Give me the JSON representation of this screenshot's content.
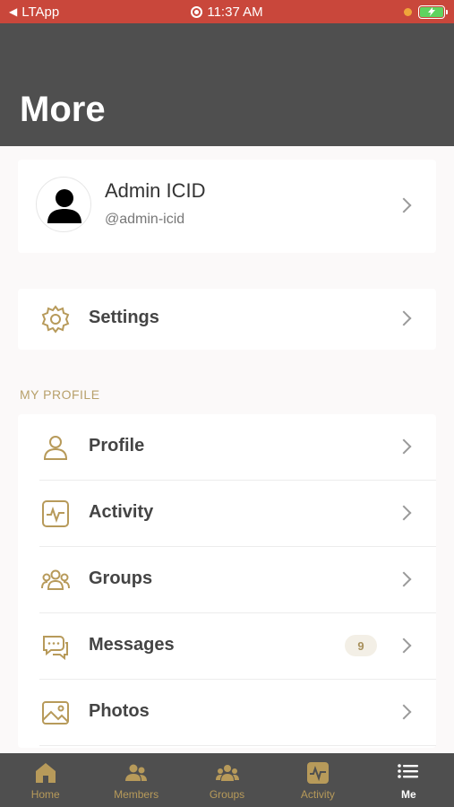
{
  "status_bar": {
    "back_app": "LTApp",
    "time": "11:37 AM",
    "bar_color": "#c9473b"
  },
  "header": {
    "title": "More",
    "bg": "#4f4f4f"
  },
  "user": {
    "name": "Admin ICID",
    "handle": "@admin-icid",
    "avatar_icon": "person-silhouette-icon"
  },
  "settings": {
    "label": "Settings",
    "icon": "gear-icon"
  },
  "my_profile": {
    "section_label": "MY PROFILE",
    "items": [
      {
        "label": "Profile",
        "icon": "person-icon"
      },
      {
        "label": "Activity",
        "icon": "activity-icon"
      },
      {
        "label": "Groups",
        "icon": "groups-icon"
      },
      {
        "label": "Messages",
        "icon": "messages-icon",
        "badge": "9"
      },
      {
        "label": "Photos",
        "icon": "photos-icon"
      }
    ]
  },
  "tabbar": {
    "items": [
      {
        "label": "Home",
        "icon": "home-icon"
      },
      {
        "label": "Members",
        "icon": "members-icon"
      },
      {
        "label": "Groups",
        "icon": "groups-icon"
      },
      {
        "label": "Activity",
        "icon": "activity-icon"
      },
      {
        "label": "Me",
        "icon": "menu-icon",
        "active": true
      }
    ]
  },
  "colors": {
    "accent": "#b79a5a",
    "text": "#444444"
  }
}
